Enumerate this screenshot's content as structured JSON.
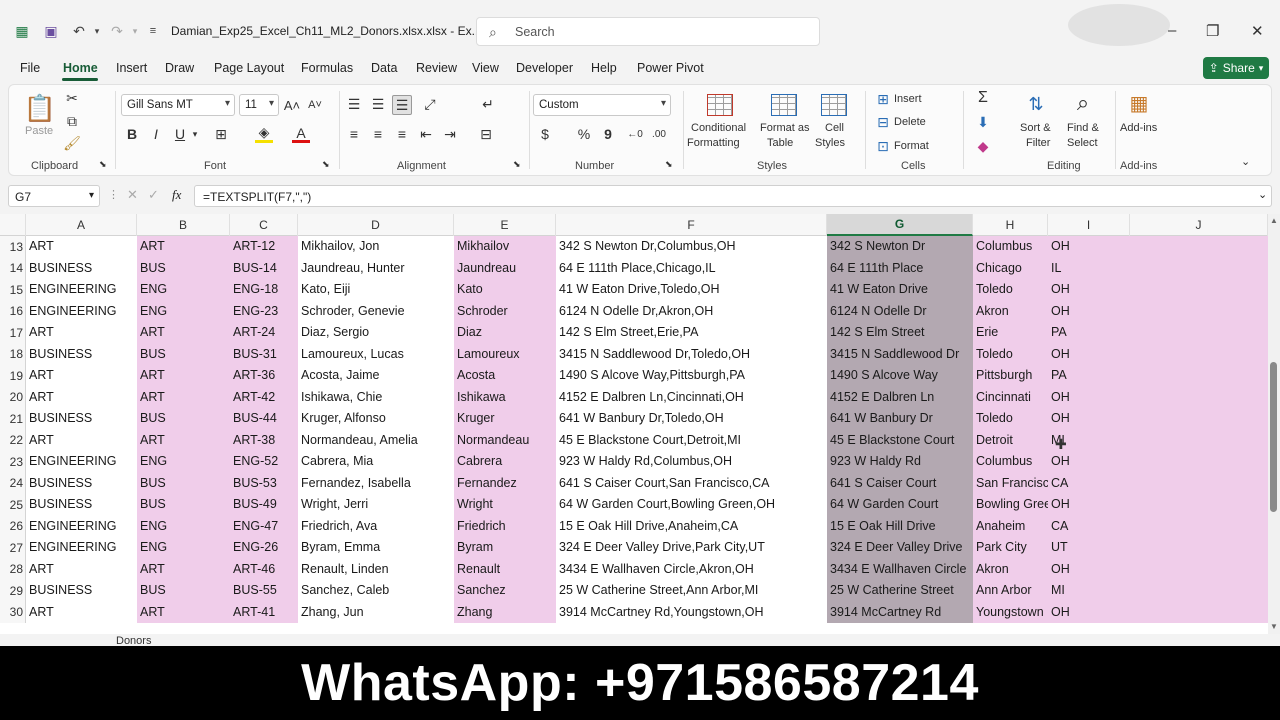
{
  "window": {
    "title": "Damian_Exp25_Excel_Ch11_ML2_Donors.xlsx.xlsx  -  Ex...",
    "search_placeholder": "Search"
  },
  "menu": {
    "tabs": [
      "File",
      "Home",
      "Insert",
      "Draw",
      "Page Layout",
      "Formulas",
      "Data",
      "Review",
      "View",
      "Developer",
      "Help",
      "Power Pivot"
    ],
    "active": "Home",
    "share_label": "Share"
  },
  "ribbon": {
    "clipboard": {
      "paste": "Paste",
      "label": "Clipboard"
    },
    "font": {
      "name": "Gill Sans MT",
      "size": "11",
      "label": "Font"
    },
    "alignment": {
      "label": "Alignment"
    },
    "number": {
      "format": "Custom",
      "label": "Number"
    },
    "styles": {
      "conditional": [
        "Conditional",
        "Formatting"
      ],
      "format_table": [
        "Format as",
        "Table"
      ],
      "cell_styles": [
        "Cell",
        "Styles"
      ],
      "label": "Styles"
    },
    "cells": {
      "insert": "Insert",
      "delete": "Delete",
      "format": "Format",
      "label": "Cells"
    },
    "editing": {
      "sort": [
        "Sort &",
        "Filter"
      ],
      "find": [
        "Find &",
        "Select"
      ],
      "label": "Editing"
    },
    "addins": {
      "button": "Add-ins",
      "label": "Add-ins"
    }
  },
  "formula_bar": {
    "name_box": "G7",
    "fx": "fx",
    "formula": "=TEXTSPLIT(F7,\",\")"
  },
  "grid": {
    "columns": [
      "A",
      "B",
      "C",
      "D",
      "E",
      "F",
      "G",
      "H",
      "I",
      "J"
    ],
    "selected_column": "G",
    "rows": [
      {
        "n": "13",
        "cells": [
          "ART",
          "ART",
          "ART-12",
          "Mikhailov, Jon",
          "Mikhailov",
          "342 S Newton Dr,Columbus,OH",
          "342 S Newton Dr",
          "Columbus",
          "OH"
        ]
      },
      {
        "n": "14",
        "cells": [
          "BUSINESS",
          "BUS",
          "BUS-14",
          "Jaundreau, Hunter",
          "Jaundreau",
          "64 E 111th Place,Chicago,IL",
          "64 E 111th Place",
          "Chicago",
          "IL"
        ]
      },
      {
        "n": "15",
        "cells": [
          "ENGINEERING",
          "ENG",
          "ENG-18",
          "Kato, Eiji",
          "Kato",
          "41 W Eaton Drive,Toledo,OH",
          "41 W Eaton Drive",
          "Toledo",
          "OH"
        ]
      },
      {
        "n": "16",
        "cells": [
          "ENGINEERING",
          "ENG",
          "ENG-23",
          "Schroder, Genevie",
          "Schroder",
          "6124 N Odelle Dr,Akron,OH",
          "6124 N Odelle Dr",
          "Akron",
          "OH"
        ]
      },
      {
        "n": "17",
        "cells": [
          "ART",
          "ART",
          "ART-24",
          "Diaz, Sergio",
          "Diaz",
          "142 S Elm Street,Erie,PA",
          "142 S Elm Street",
          "Erie",
          "PA"
        ]
      },
      {
        "n": "18",
        "cells": [
          "BUSINESS",
          "BUS",
          "BUS-31",
          "Lamoureux, Lucas",
          "Lamoureux",
          "3415 N Saddlewood Dr,Toledo,OH",
          "3415 N Saddlewood Dr",
          "Toledo",
          "OH"
        ]
      },
      {
        "n": "19",
        "cells": [
          "ART",
          "ART",
          "ART-36",
          "Acosta, Jaime",
          "Acosta",
          "1490 S Alcove Way,Pittsburgh,PA",
          "1490 S Alcove Way",
          "Pittsburgh",
          "PA"
        ]
      },
      {
        "n": "20",
        "cells": [
          "ART",
          "ART",
          "ART-42",
          "Ishikawa, Chie",
          "Ishikawa",
          "4152 E Dalbren Ln,Cincinnati,OH",
          "4152 E Dalbren Ln",
          "Cincinnati",
          "OH"
        ]
      },
      {
        "n": "21",
        "cells": [
          "BUSINESS",
          "BUS",
          "BUS-44",
          "Kruger, Alfonso",
          "Kruger",
          "641 W Banbury Dr,Toledo,OH",
          "641 W Banbury Dr",
          "Toledo",
          "OH"
        ]
      },
      {
        "n": "22",
        "cells": [
          "ART",
          "ART",
          "ART-38",
          "Normandeau, Amelia",
          "Normandeau",
          "45 E Blackstone Court,Detroit,MI",
          "45 E Blackstone Court",
          "Detroit",
          "MI"
        ]
      },
      {
        "n": "23",
        "cells": [
          "ENGINEERING",
          "ENG",
          "ENG-52",
          "Cabrera, Mia",
          "Cabrera",
          "923 W Haldy Rd,Columbus,OH",
          "923 W Haldy Rd",
          "Columbus",
          "OH"
        ]
      },
      {
        "n": "24",
        "cells": [
          "BUSINESS",
          "BUS",
          "BUS-53",
          "Fernandez,  Isabella",
          "Fernandez",
          "641 S Caiser Court,San Francisco,CA",
          "641 S Caiser Court",
          "San Francisco",
          "CA"
        ]
      },
      {
        "n": "25",
        "cells": [
          "BUSINESS",
          "BUS",
          "BUS-49",
          "Wright,  Jerri",
          "Wright",
          "64 W Garden Court,Bowling Green,OH",
          "64 W Garden Court",
          "Bowling Green",
          "OH"
        ]
      },
      {
        "n": "26",
        "cells": [
          "ENGINEERING",
          "ENG",
          "ENG-47",
          "Friedrich, Ava",
          "Friedrich",
          "15 E Oak Hill Drive,Anaheim,CA",
          "15 E Oak Hill Drive",
          "Anaheim",
          "CA"
        ]
      },
      {
        "n": "27",
        "cells": [
          "ENGINEERING",
          "ENG",
          "ENG-26",
          "Byram,  Emma",
          "Byram",
          "324 E Deer Valley Drive,Park City,UT",
          "324 E Deer Valley Drive",
          "Park City",
          "UT"
        ]
      },
      {
        "n": "28",
        "cells": [
          "ART",
          "ART",
          "ART-46",
          "Renault, Linden",
          "Renault",
          "3434 E Wallhaven Circle,Akron,OH",
          "3434 E Wallhaven Circle",
          "Akron",
          "OH"
        ]
      },
      {
        "n": "29",
        "cells": [
          "BUSINESS",
          "BUS",
          "BUS-55",
          "Sanchez,  Caleb",
          "Sanchez",
          "25 W Catherine Street,Ann Arbor,MI",
          "25 W Catherine Street",
          "Ann Arbor",
          "MI"
        ]
      },
      {
        "n": "30",
        "cells": [
          "ART",
          "ART",
          "ART-41",
          "Zhang, Jun",
          "Zhang",
          "3914 McCartney Rd,Youngstown,OH",
          "3914 McCartney Rd",
          "Youngstown",
          "OH"
        ]
      }
    ]
  },
  "sheet_tab": "Donors",
  "banner": "WhatsApp: +971586587214",
  "colors": {
    "accent": "#1f7a44",
    "pink_fill": "#f0cdea",
    "selected_fill": "#b3a8b1"
  }
}
